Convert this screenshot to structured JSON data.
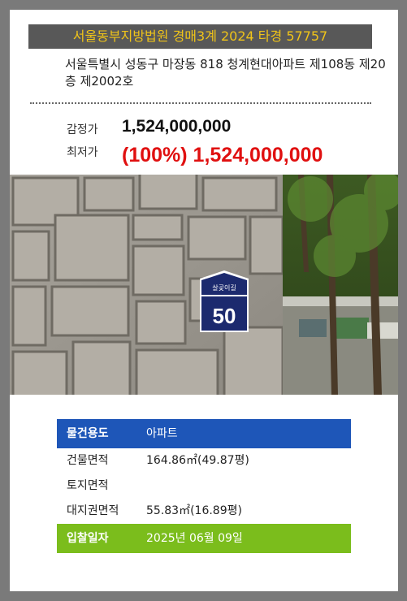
{
  "header": {
    "case_title": "서울동부지방법원 경매3계 2024 타경 57757"
  },
  "property": {
    "address": "서울특별시 성동구 마장동 818 청계현대아파트 제108동 제20층 제2002호"
  },
  "prices": {
    "appraisal_label": "감정가",
    "appraisal_value": "1,524,000,000",
    "minimum_label": "최저가",
    "minimum_value": "(100%) 1,524,000,000"
  },
  "photo": {
    "sign_small_text": "살곶이길",
    "sign_number": "50"
  },
  "details": {
    "usage_label": "물건용도",
    "usage_value": "아파트",
    "building_area_label": "건물면적",
    "building_area_value": "164.86㎡(49.87평)",
    "land_area_label": "토지면적",
    "land_area_value": "",
    "land_right_label": "대지권면적",
    "land_right_value": "55.83㎡(16.89평)",
    "bid_date_label": "입찰일자",
    "bid_date_value": "2025년 06월 09일"
  },
  "colors": {
    "header_bg": "#585858",
    "header_text": "#f0c419",
    "minimum_price": "#e01010",
    "usage_row_bg": "#1e56b8",
    "bid_row_bg": "#7bbd1c"
  }
}
